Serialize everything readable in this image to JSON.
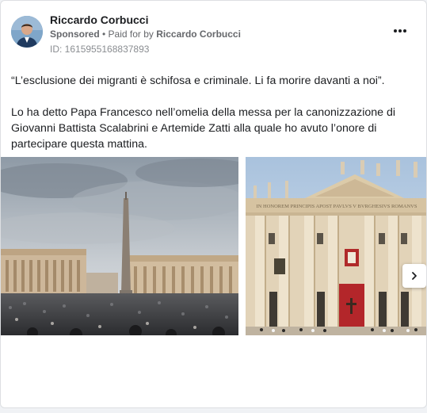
{
  "post": {
    "author": "Riccardo Corbucci",
    "sponsored_label": "Sponsored",
    "separator": " • ",
    "paid_for_prefix": "Paid for by ",
    "paid_for_by": "Riccardo Corbucci",
    "ad_id": "ID: 1615955168837893",
    "paragraphs": [
      "“L’esclusione dei migranti è schifosa e criminale. Li fa morire davanti a noi”.",
      "Lo ha detto Papa Francesco nell’omelia della messa per la canonizzazione di Giovanni Battista Scalabrini e Artemide Zatti alla quale ho avuto l’onore di partecipare questa mattina."
    ]
  },
  "carousel": {
    "slides": [
      {
        "name": "st-peters-square-crowd-photo"
      },
      {
        "name": "st-peters-basilica-facade-photo"
      }
    ],
    "basilica_inscription": "IN HONOREM PRINCIPIS APOST PAVLVS V BVRGHESIVS ROMANVS"
  },
  "icons": {
    "more": "more-options-icon",
    "next": "chevron-right-icon"
  },
  "colors": {
    "text_primary": "#1c1e21",
    "text_secondary": "#65676b",
    "card_border": "#dddfe2"
  }
}
